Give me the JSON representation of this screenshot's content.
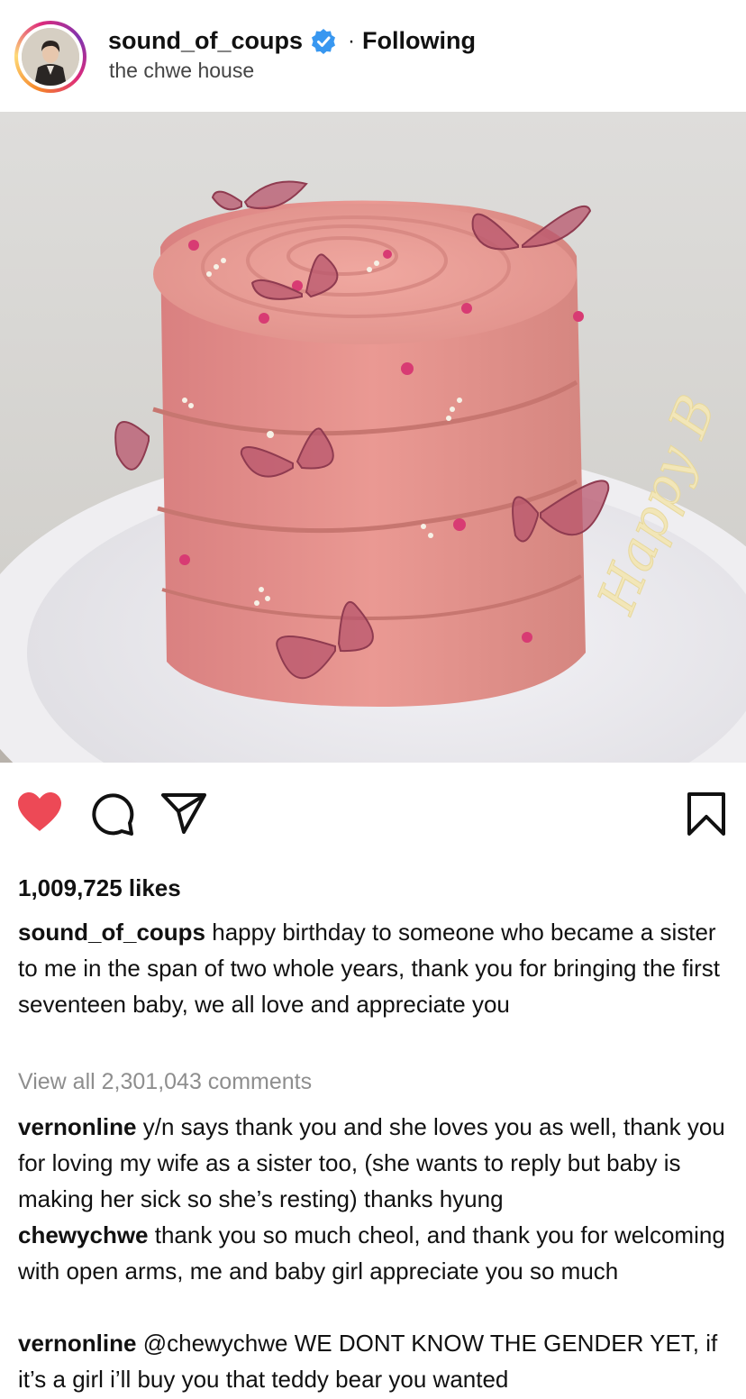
{
  "post": {
    "username": "sound_of_coups",
    "separator": "·",
    "following_label": "Following",
    "location": "the chwe house",
    "likes": "1,009,725 likes",
    "caption_user": "sound_of_coups",
    "caption_text": "happy birthday to someone who became a sister to me in the span of two whole years, thank you for bringing the first seventeen baby, we all love and appreciate you",
    "view_all_comments": "View all 2,301,043 comments",
    "photo_text": "Happy B"
  },
  "comments": [
    {
      "user": "vernonline",
      "text": "y/n says thank you and she loves you as well, thank you for loving my wife as a sister too, (she wants to reply but baby is making her sick so she’s resting) thanks hyung"
    },
    {
      "user": "chewychwe",
      "text": "thank you so much cheol, and thank you for welcoming with open arms, me and baby girl appreciate you so much"
    },
    {
      "user": "vernonline",
      "text": "@chewychwe WE DONT KNOW THE GENDER YET, if it’s a girl i’ll buy you that teddy bear you wanted"
    }
  ],
  "colors": {
    "like_red": "#ed4956",
    "verified_blue": "#3897f0",
    "muted_grey": "#8e8e8e"
  },
  "icons": {
    "like": "heart-icon",
    "comment": "comment-icon",
    "share": "paper-plane-icon",
    "save": "bookmark-icon",
    "verified": "verified-badge-icon"
  }
}
